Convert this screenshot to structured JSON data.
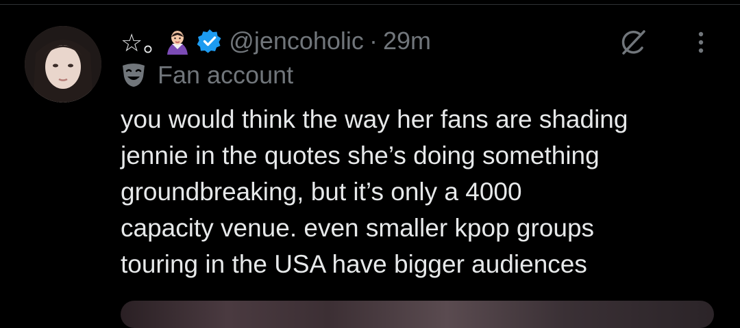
{
  "post": {
    "display_name": "☆｡",
    "handle": "@jencoholic",
    "separator": "·",
    "timestamp": "29m",
    "label": "Fan account",
    "text_lines": [
      "you would think the way her fans are shading",
      "jennie in the quotes she’s doing something",
      "groundbreaking, but it’s only a 4000",
      "capacity venue. even smaller kpop groups",
      "touring in the USA have bigger audiences"
    ]
  },
  "icons": {
    "emoji": "vampire-emoji-icon",
    "verified": "verified-badge-icon",
    "grok": "grok-icon",
    "more": "more-options-icon",
    "label": "theater-mask-icon"
  },
  "colors": {
    "background": "#000000",
    "text_primary": "#e7e9ea",
    "text_secondary": "#71767b",
    "verified_blue": "#1d9bf0"
  }
}
